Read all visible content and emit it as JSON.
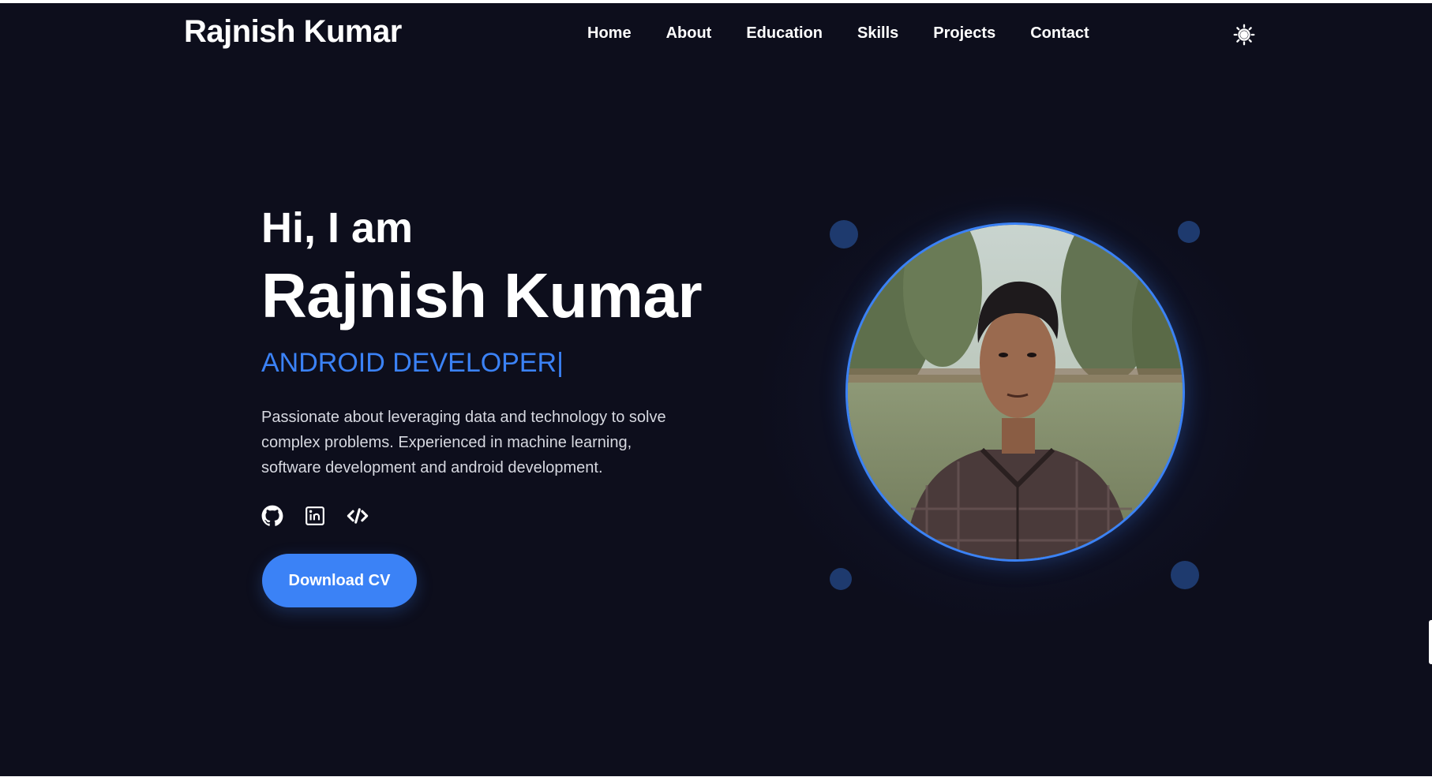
{
  "header": {
    "brand": "Rajnish Kumar",
    "nav": [
      "Home",
      "About",
      "Education",
      "Skills",
      "Projects",
      "Contact"
    ],
    "theme_icon": "sun-icon"
  },
  "hero": {
    "greeting": "Hi, I am",
    "name": "Rajnish Kumar",
    "role": "ANDROID DEVELOPER",
    "role_cursor": "|",
    "bio": "Passionate about leveraging data and technology to solve complex problems. Experienced in machine learning, software development and android development.",
    "socials": [
      "github-icon",
      "linkedin-icon",
      "code-icon"
    ],
    "cta_label": "Download CV"
  },
  "colors": {
    "background": "#0d0e1c",
    "accent": "#3b82f6",
    "text": "#ffffff",
    "dot": "#1e3a6e"
  }
}
